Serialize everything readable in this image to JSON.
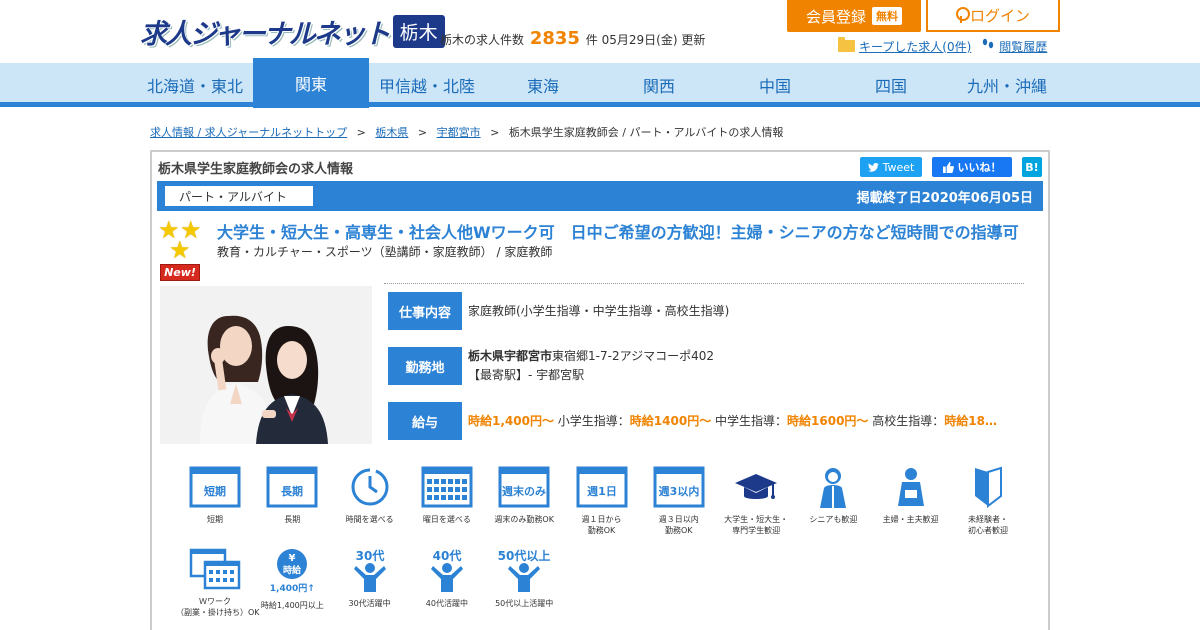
{
  "header": {
    "logo_text": "求人ジャーナルネット",
    "logo_pref": "栃木",
    "count_prefix": "栃木の求人件数",
    "count_value": "2835",
    "count_suffix": "件 05月29日(金) 更新",
    "register_label": "会員登録",
    "register_badge": "無料",
    "login_label": "ログイン",
    "kept_jobs_label": "キープした求人(0件)",
    "history_label": "閲覧履歴"
  },
  "nav": {
    "items": [
      "北海道・東北",
      "関東",
      "甲信越・北陸",
      "東海",
      "関西",
      "中国",
      "四国",
      "九州・沖縄"
    ],
    "active": "関東"
  },
  "breadcrumb": {
    "items": [
      "求人情報 / 求人ジャーナルネットトップ",
      "栃木県",
      "宇都宮市"
    ],
    "current": "栃木県学生家庭教師会 / パート・アルバイトの求人情報"
  },
  "panel": {
    "title": "栃木県学生家庭教師会の求人情報",
    "tweet_label": "Tweet",
    "like_label": "いいね！",
    "hatena_label": "B!",
    "employment_type": "パート・アルバイト",
    "end_date": "掲載終了日2020年06月05日",
    "new_badge": "New!",
    "job_title": "大学生・短大生・高専生・社会人他Wワーク可　日中ご希望の方歓迎！主婦・シニアの方など短時間での指導可",
    "job_category": "教育・カルチャー・スポーツ（塾講師・家庭教師） / 家庭教師"
  },
  "info": {
    "work_label": "仕事内容",
    "work_value": "家庭教師(小学生指導・中学生指導・高校生指導)",
    "location_label": "勤務地",
    "location_city": "栃木県宇都宮市",
    "location_address": "東宿郷1-7-2アジマコーポ402",
    "location_station": "【最寄駅】- 宇都宮駅",
    "salary_label": "給与",
    "salary_1": "時給1,400円～",
    "salary_2_prefix": " 小学生指導：",
    "salary_2": "時給1400円～",
    "salary_3_prefix": " 中学生指導：",
    "salary_3": "時給1600円～",
    "salary_4_prefix": " 高校生指導：",
    "salary_4": "時給18…"
  },
  "features": [
    {
      "icon": "calendar-short-icon",
      "badge": "短期",
      "label": "短期"
    },
    {
      "icon": "calendar-long-icon",
      "badge": "長期",
      "label": "長期"
    },
    {
      "icon": "clock-icon",
      "badge": "",
      "label": "時間を選べる"
    },
    {
      "icon": "calendar-grid-icon",
      "badge": "",
      "label": "曜日を選べる"
    },
    {
      "icon": "calendar-weekend-icon",
      "badge": "週末のみ",
      "label": "週末のみ勤務OK"
    },
    {
      "icon": "calendar-1day-icon",
      "badge": "週1日",
      "label": "週１日から\n勤務OK"
    },
    {
      "icon": "calendar-3days-icon",
      "badge": "週3以内",
      "label": "週３日以内\n勤務OK"
    },
    {
      "icon": "graduation-cap-icon",
      "badge": "",
      "label": "大学生・短大生・\n専門学生歓迎"
    },
    {
      "icon": "senior-icon",
      "badge": "",
      "label": "シニアも歓迎"
    },
    {
      "icon": "apron-icon",
      "badge": "",
      "label": "主婦・主夫歓迎"
    },
    {
      "icon": "beginner-mark-icon",
      "badge": "",
      "label": "未経験者・\n初心者歓迎"
    },
    {
      "icon": "double-calendar-icon",
      "badge": "",
      "label": "Ｗワーク\n（副業・掛け持ち）OK"
    },
    {
      "icon": "hourly-wage-icon",
      "badge": "時給",
      "sub": "1,400円↑",
      "label": "時給1,400円以上"
    },
    {
      "icon": "age-30s-icon",
      "badge": "30代",
      "label": "30代活躍中"
    },
    {
      "icon": "age-40s-icon",
      "badge": "40代",
      "label": "40代活躍中"
    },
    {
      "icon": "age-50s-icon",
      "badge": "50代以上",
      "label": "50代以上活躍中"
    }
  ],
  "colors": {
    "brand_blue": "#2c82d4",
    "orange": "#f08300",
    "nav_bg": "#cde6f7",
    "logo_navy": "#1d3a8a"
  }
}
